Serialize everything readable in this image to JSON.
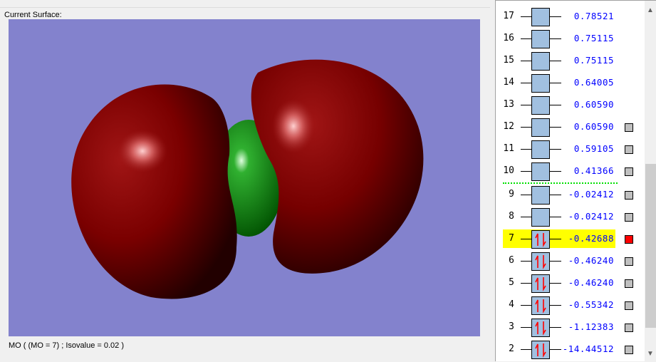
{
  "surface": {
    "group_label": "Current Surface:",
    "caption": "MO ( (MO = 7) ; Isovalue = 0.02 )"
  },
  "colors": {
    "background": "#8382cd",
    "positive_lobe": "#8b0000",
    "negative_lobe": "#0a8a0a",
    "selected": "#ffff00",
    "homo_lumo_line": "#00e000"
  },
  "orbitals": [
    {
      "n": "17",
      "energy": "0.78521",
      "occupied": false,
      "check": "none"
    },
    {
      "n": "16",
      "energy": "0.75115",
      "occupied": false,
      "check": "none"
    },
    {
      "n": "15",
      "energy": "0.75115",
      "occupied": false,
      "check": "none"
    },
    {
      "n": "14",
      "energy": "0.64005",
      "occupied": false,
      "check": "none"
    },
    {
      "n": "13",
      "energy": "0.60590",
      "occupied": false,
      "check": "none"
    },
    {
      "n": "12",
      "energy": "0.60590",
      "occupied": false,
      "check": "off"
    },
    {
      "n": "11",
      "energy": "0.59105",
      "occupied": false,
      "check": "off"
    },
    {
      "n": "10",
      "energy": "0.41366",
      "occupied": false,
      "check": "off"
    },
    {
      "n": "9",
      "energy": "-0.02412",
      "occupied": false,
      "check": "off"
    },
    {
      "n": "8",
      "energy": "-0.02412",
      "occupied": false,
      "check": "off"
    },
    {
      "n": "7",
      "energy": "-0.42688",
      "occupied": true,
      "check": "on",
      "selected": true
    },
    {
      "n": "6",
      "energy": "-0.46240",
      "occupied": true,
      "check": "off"
    },
    {
      "n": "5",
      "energy": "-0.46240",
      "occupied": true,
      "check": "off"
    },
    {
      "n": "4",
      "energy": "-0.55342",
      "occupied": true,
      "check": "off"
    },
    {
      "n": "3",
      "energy": "-1.12383",
      "occupied": true,
      "check": "off"
    },
    {
      "n": "2",
      "energy": "-14.44512",
      "occupied": true,
      "check": "off"
    }
  ]
}
